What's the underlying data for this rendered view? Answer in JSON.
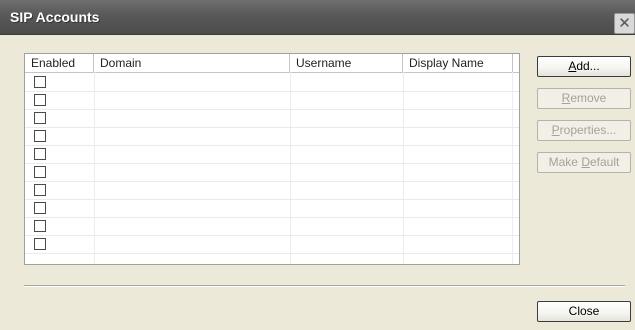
{
  "window": {
    "title": "SIP Accounts",
    "close_glyph": "✕"
  },
  "table": {
    "columns": [
      "Enabled",
      "Domain",
      "Username",
      "Display Name"
    ],
    "rows": [
      {
        "enabled": false,
        "domain": "",
        "username": "",
        "display_name": ""
      },
      {
        "enabled": false,
        "domain": "",
        "username": "",
        "display_name": ""
      },
      {
        "enabled": false,
        "domain": "",
        "username": "",
        "display_name": ""
      },
      {
        "enabled": false,
        "domain": "",
        "username": "",
        "display_name": ""
      },
      {
        "enabled": false,
        "domain": "",
        "username": "",
        "display_name": ""
      },
      {
        "enabled": false,
        "domain": "",
        "username": "",
        "display_name": ""
      },
      {
        "enabled": false,
        "domain": "",
        "username": "",
        "display_name": ""
      },
      {
        "enabled": false,
        "domain": "",
        "username": "",
        "display_name": ""
      },
      {
        "enabled": false,
        "domain": "",
        "username": "",
        "display_name": ""
      },
      {
        "enabled": false,
        "domain": "",
        "username": "",
        "display_name": ""
      }
    ]
  },
  "buttons": {
    "add": {
      "pre": "",
      "key": "A",
      "post": "dd...",
      "enabled": true
    },
    "remove": {
      "pre": "",
      "key": "R",
      "post": "emove",
      "enabled": false
    },
    "properties": {
      "pre": "",
      "key": "P",
      "post": "roperties...",
      "enabled": false
    },
    "make_default": {
      "pre": "Make ",
      "key": "D",
      "post": "efault",
      "enabled": false
    },
    "close": {
      "label": "Close",
      "enabled": true
    }
  }
}
